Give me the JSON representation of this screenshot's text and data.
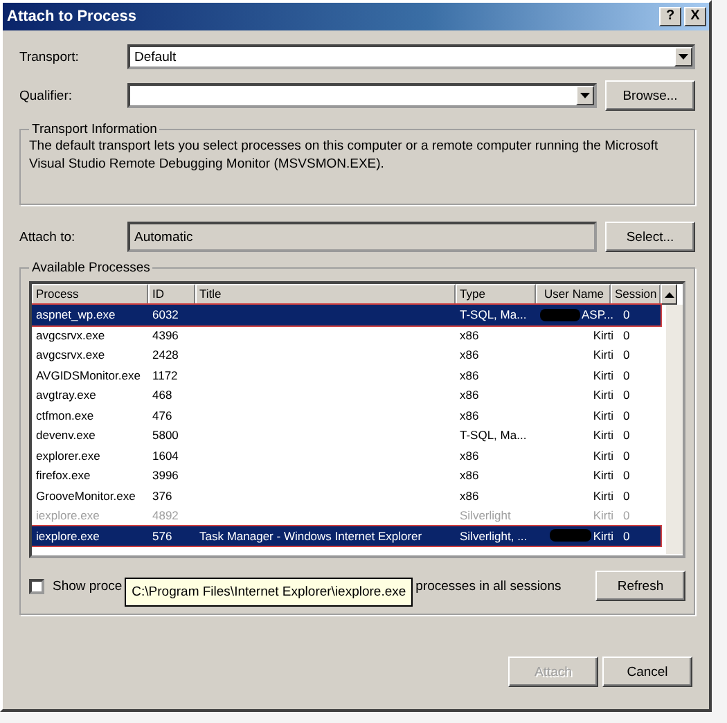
{
  "window": {
    "title": "Attach to Process",
    "help_button": "?",
    "close_button": "X"
  },
  "transport": {
    "label": "Transport:",
    "value": "Default"
  },
  "qualifier": {
    "label": "Qualifier:",
    "browse_button": "Browse..."
  },
  "transport_info": {
    "heading": "Transport Information",
    "text": "The default transport lets you select processes on this computer or a remote computer running the Microsoft Visual Studio Remote Debugging Monitor (MSVSMON.EXE)."
  },
  "attach_to": {
    "label": "Attach to:",
    "value": "Automatic",
    "select_button": "Select..."
  },
  "processes": {
    "heading": "Available Processes",
    "columns": [
      "Process",
      "ID",
      "Title",
      "Type",
      "User Name",
      "Session"
    ],
    "rows": [
      {
        "process": "aspnet_wp.exe",
        "id": "6032",
        "type": "T-SQL, Ma...",
        "user": "ASP...",
        "session": "0",
        "selected": true,
        "disabled": false,
        "redacted": true,
        "outlined": true
      },
      {
        "process": "avgcsrvx.exe",
        "id": "4396",
        "type": "x86",
        "user": "Kirti",
        "session": "0",
        "selected": false,
        "disabled": false,
        "redacted": false,
        "outlined": false
      },
      {
        "process": "avgcsrvx.exe",
        "id": "2428",
        "type": "x86",
        "user": "Kirti",
        "session": "0",
        "selected": false,
        "disabled": false,
        "redacted": false,
        "outlined": false
      },
      {
        "process": "AVGIDSMonitor.exe",
        "id": "1172",
        "type": "x86",
        "user": "Kirti",
        "session": "0",
        "selected": false,
        "disabled": false,
        "redacted": false,
        "outlined": false
      },
      {
        "process": "avgtray.exe",
        "id": "468",
        "type": "x86",
        "user": "Kirti",
        "session": "0",
        "selected": false,
        "disabled": false,
        "redacted": false,
        "outlined": false
      },
      {
        "process": "ctfmon.exe",
        "id": "476",
        "type": "x86",
        "user": "Kirti",
        "session": "0",
        "selected": false,
        "disabled": false,
        "redacted": false,
        "outlined": false
      },
      {
        "process": "devenv.exe",
        "id": "5800",
        "type": "T-SQL, Ma...",
        "user": "Kirti",
        "session": "0",
        "selected": false,
        "disabled": false,
        "redacted": false,
        "outlined": false
      },
      {
        "process": "explorer.exe",
        "id": "1604",
        "type": "x86",
        "user": "Kirti",
        "session": "0",
        "selected": false,
        "disabled": false,
        "redacted": false,
        "outlined": false
      },
      {
        "process": "firefox.exe",
        "id": "3996",
        "type": "x86",
        "user": "Kirti",
        "session": "0",
        "selected": false,
        "disabled": false,
        "redacted": false,
        "outlined": false
      },
      {
        "process": "GrooveMonitor.exe",
        "id": "376",
        "type": "x86",
        "user": "Kirti",
        "session": "0",
        "selected": false,
        "disabled": false,
        "redacted": false,
        "outlined": false
      },
      {
        "process": "iexplore.exe",
        "id": "4892",
        "type": "Silverlight",
        "user": "Kirti",
        "session": "0",
        "selected": false,
        "disabled": true,
        "redacted": false,
        "outlined": false
      },
      {
        "process": "iexplore.exe",
        "id": "576",
        "title": "Task Manager - Windows Internet Explorer",
        "type": "Silverlight, ...",
        "user": "Kirti",
        "session": "0",
        "selected": true,
        "disabled": false,
        "redacted": true,
        "outlined": true
      }
    ]
  },
  "show_all_users": {
    "label": "Show proce",
    "checked": false
  },
  "show_all_sessions": {
    "label": "processes in all sessions"
  },
  "tooltip": "C:\\Program Files\\Internet Explorer\\iexplore.exe",
  "refresh_button": "Refresh",
  "attach_button": {
    "label": "Attach",
    "disabled": true
  },
  "cancel_button": "Cancel"
}
